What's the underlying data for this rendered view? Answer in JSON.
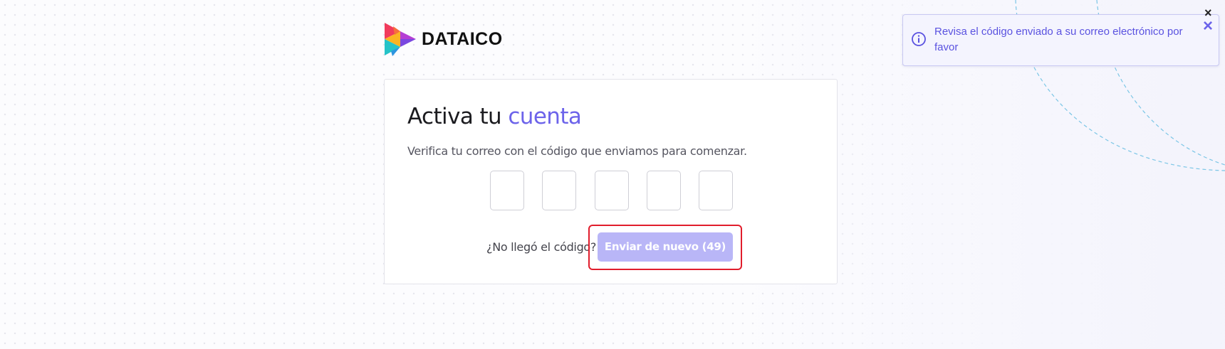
{
  "brand": {
    "name": "DATAICO",
    "logo_icon": "play-triangle-logo"
  },
  "card": {
    "title_prefix": "Activa tu",
    "title_accent": "cuenta",
    "subtitle": "Verifica tu correo con el código que enviamos para comenzar.",
    "code_inputs": [
      "",
      "",
      "",
      "",
      ""
    ],
    "resend_prompt": "¿No llegó el código?",
    "resend_button_label": "Enviar de nuevo (49)"
  },
  "toast": {
    "icon": "info-icon",
    "message": "Revisa el código enviado a su correo electrónico por favor",
    "close_icon": "×"
  },
  "corner_close_icon": "×",
  "colors": {
    "accent": "#6c63ea",
    "button_disabled": "#b9b6f7",
    "highlight_outline": "#e11d2c",
    "toast_bg": "#f4f4fe"
  }
}
